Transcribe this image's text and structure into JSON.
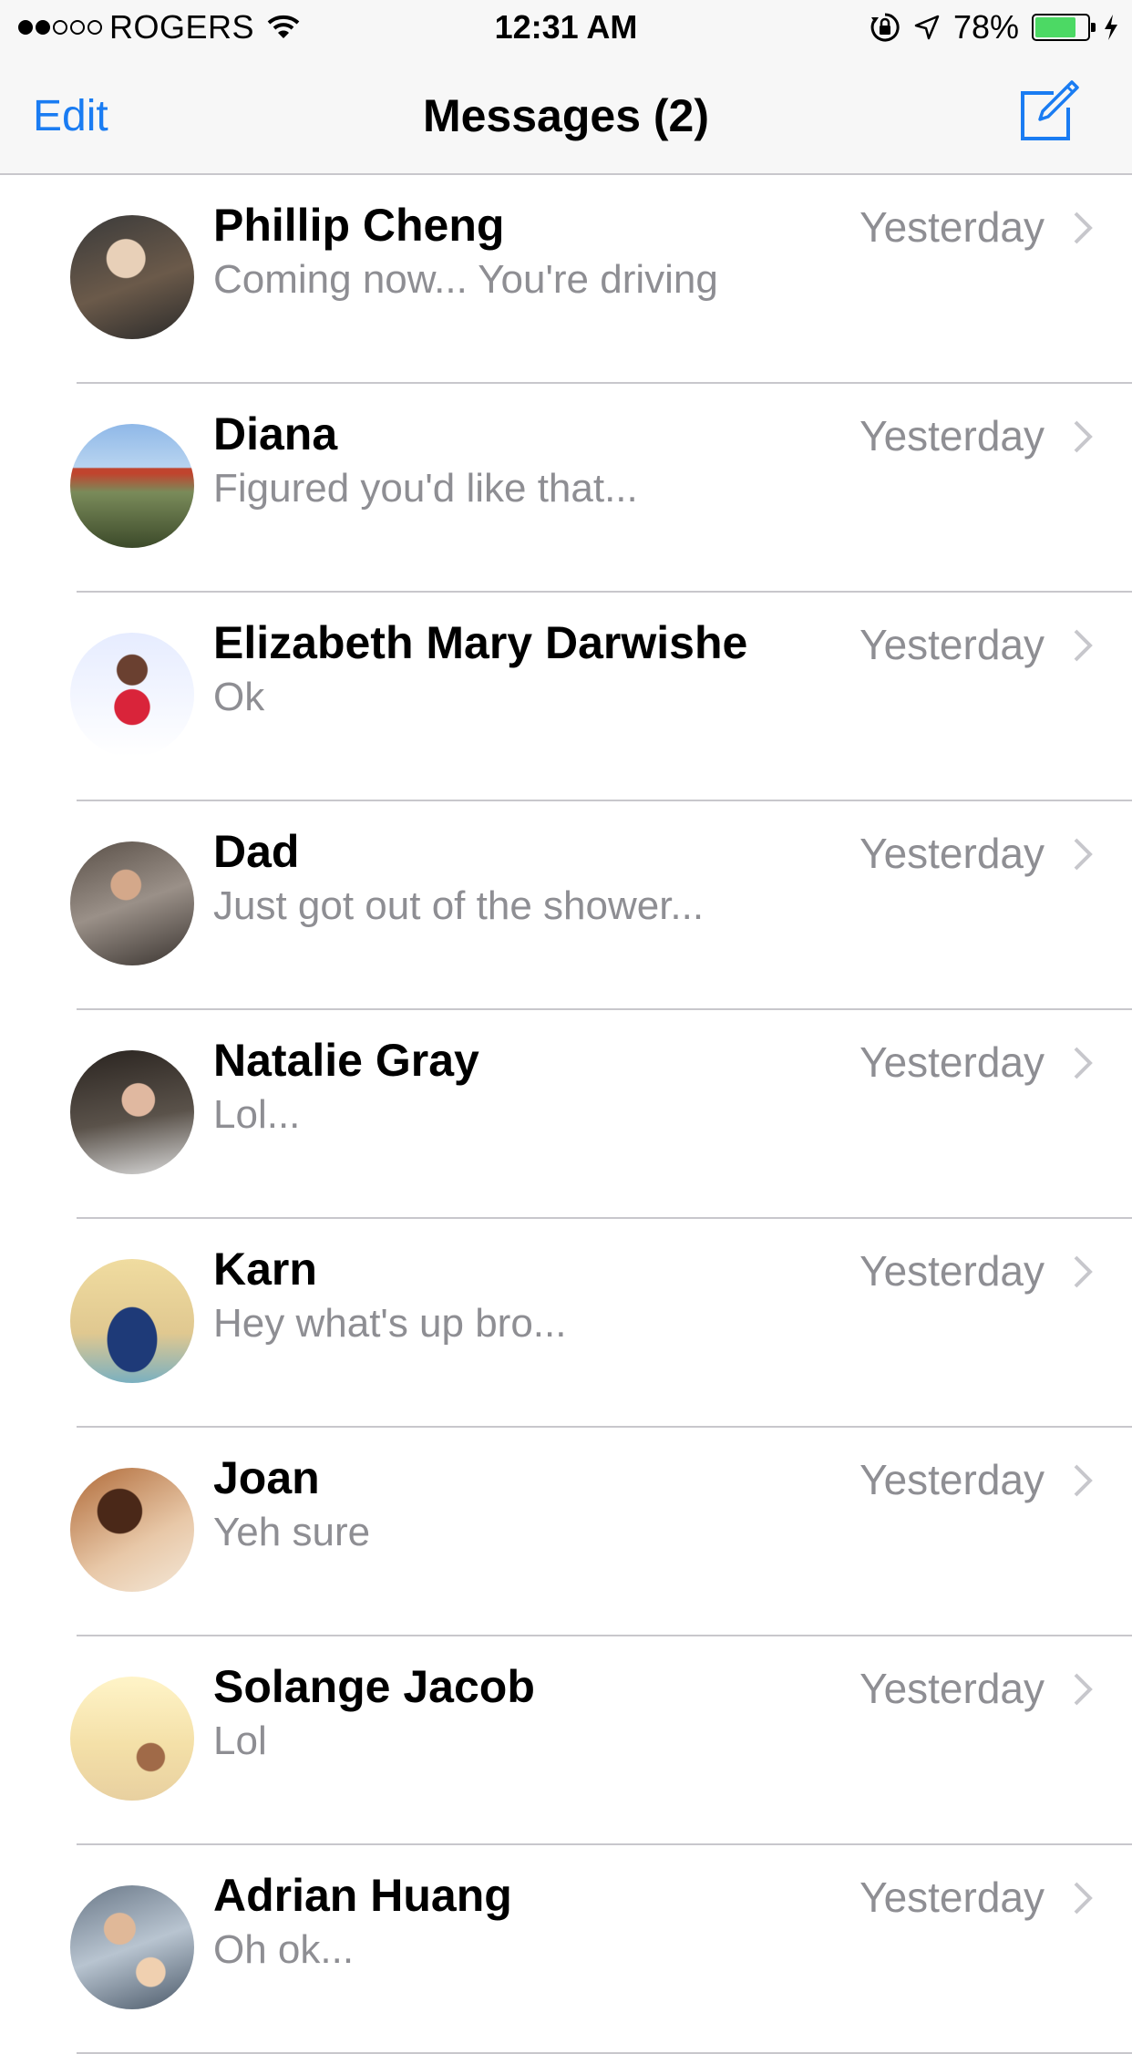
{
  "status_bar": {
    "carrier": "ROGERS",
    "time": "12:31 AM",
    "battery_percent": "78%",
    "battery_level": 0.78,
    "signal_bars_filled": 2,
    "signal_bars_total": 5,
    "battery_color": "#4cd964"
  },
  "nav": {
    "edit_label": "Edit",
    "title": "Messages (2)",
    "accent_color": "#1a7cf2"
  },
  "conversations": [
    {
      "name": "Phillip Cheng",
      "preview": "Coming now... You're driving",
      "time": "Yesterday"
    },
    {
      "name": "Diana",
      "preview": "Figured you'd like that...",
      "time": "Yesterday"
    },
    {
      "name": "Elizabeth Mary Darwishe",
      "preview": "Ok",
      "time": "Yesterday"
    },
    {
      "name": "Dad",
      "preview": "Just got out of the shower...",
      "time": "Yesterday"
    },
    {
      "name": "Natalie Gray",
      "preview": "Lol...",
      "time": "Yesterday"
    },
    {
      "name": "Karn",
      "preview": "Hey what's up bro...",
      "time": "Yesterday"
    },
    {
      "name": "Joan",
      "preview": "Yeh sure",
      "time": "Yesterday"
    },
    {
      "name": "Solange Jacob",
      "preview": "Lol",
      "time": "Yesterday"
    },
    {
      "name": "Adrian Huang",
      "preview": "Oh ok...",
      "time": "Yesterday"
    }
  ]
}
